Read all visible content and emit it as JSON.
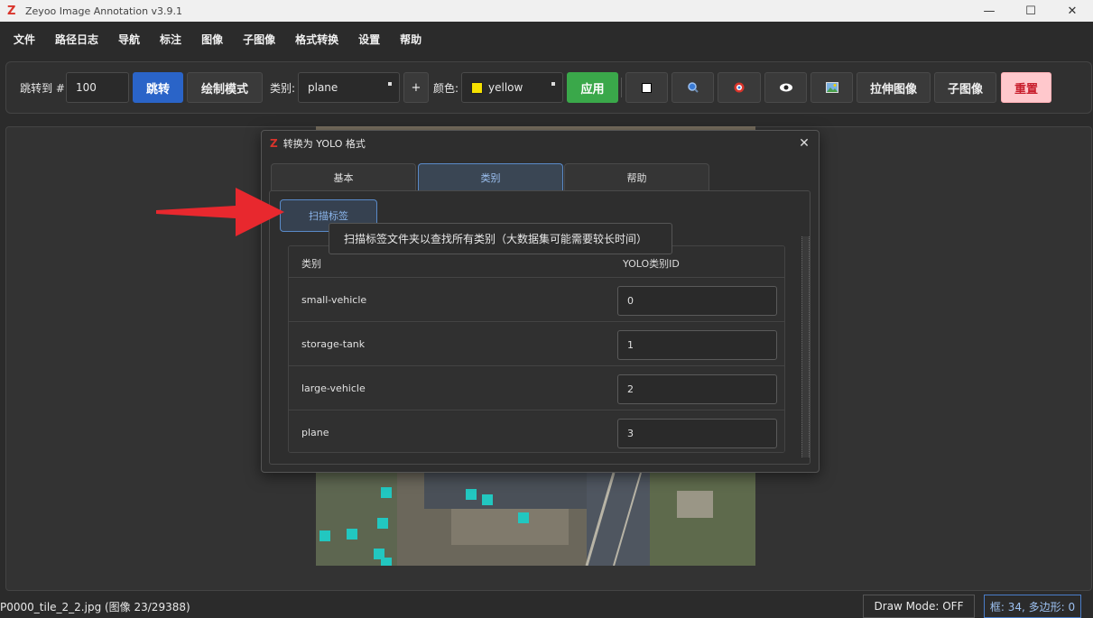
{
  "window": {
    "title": "Zeyoo Image Annotation v3.9.1",
    "logo": "Z",
    "minimize": "—",
    "maximize": "☐",
    "close": "✕"
  },
  "menu": [
    "文件",
    "路径日志",
    "导航",
    "标注",
    "图像",
    "子图像",
    "格式转换",
    "设置",
    "帮助"
  ],
  "toolbar": {
    "jump_label": "跳转到 #",
    "jump_value": "100",
    "jump_button": "跳转",
    "draw_mode_button": "绘制模式",
    "category_label": "类别:",
    "category_value": "plane",
    "add_button": "+",
    "color_label": "颜色:",
    "color_value": "yellow",
    "color_swatch": "#f5e000",
    "apply_button": "应用",
    "stretch_button": "拉伸图像",
    "subimage_button": "子图像",
    "reset_button": "重置"
  },
  "dialog": {
    "title": "转换为 YOLO 格式",
    "tabs": [
      "基本",
      "类别",
      "帮助"
    ],
    "active_tab": "类别",
    "scan_button": "扫描标签",
    "tooltip": "扫描标签文件夹以查找所有类别（大数据集可能需要较长时间）",
    "table": {
      "headers": [
        "类别",
        "YOLO类别ID"
      ],
      "rows": [
        {
          "category": "small-vehicle",
          "id": "0"
        },
        {
          "category": "storage-tank",
          "id": "1"
        },
        {
          "category": "large-vehicle",
          "id": "2"
        },
        {
          "category": "plane",
          "id": "3"
        }
      ]
    }
  },
  "status": {
    "file": "P0000_tile_2_2.jpg (图像 23/29388)",
    "draw_mode": "Draw Mode: OFF",
    "counts": "框: 34, 多边形: 0"
  },
  "colors": {
    "accent_blue": "#2a64c8",
    "apply_green": "#3aa84a",
    "reset_pink": "#ffc8cc",
    "annotation_cyan": "#22c7c0",
    "arrow_red": "#e8282e"
  }
}
